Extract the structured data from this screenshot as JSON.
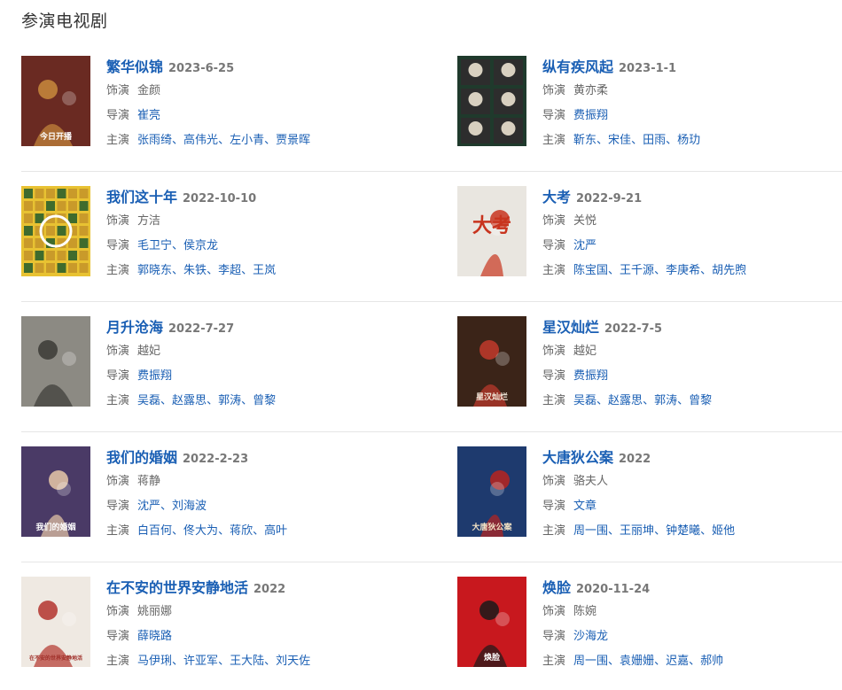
{
  "section_title": "参演电视剧",
  "labels": {
    "role": "饰演",
    "director": "导演",
    "cast": "主演"
  },
  "dramas": [
    {
      "title": "繁华似锦",
      "date": "2023-6-25",
      "role": "金颜",
      "directors": [
        "崔亮"
      ],
      "cast": [
        "张雨绮",
        "高伟光",
        "左小青",
        "贾景晖"
      ],
      "poster_text": "今日开播",
      "colors": {
        "bg": "#6a2a22",
        "accent": "#c8893c",
        "text": "#ffffff"
      }
    },
    {
      "title": "纵有疾风起",
      "date": "2023-1-1",
      "role": "黄亦柔",
      "directors": [
        "费振翔"
      ],
      "cast": [
        "靳东",
        "宋佳",
        "田雨",
        "杨玏"
      ],
      "poster_text": "",
      "colors": {
        "bg": "#1f3a2c",
        "accent": "#d8d0c0",
        "text": "#ffffff"
      }
    },
    {
      "title": "我们这十年",
      "date": "2022-10-10",
      "role": "方洁",
      "directors": [
        "毛卫宁",
        "侯京龙"
      ],
      "cast": [
        "郭晓东",
        "朱铁",
        "李超",
        "王岚"
      ],
      "poster_text": "",
      "colors": {
        "bg": "#e8c232",
        "accent": "#3f6b2d",
        "text": "#ffffff"
      }
    },
    {
      "title": "大考",
      "date": "2022-9-21",
      "role": "关悦",
      "directors": [
        "沈严"
      ],
      "cast": [
        "陈宝国",
        "王千源",
        "李庚希",
        "胡先煦"
      ],
      "poster_text": "大考",
      "colors": {
        "bg": "#e9e6e0",
        "accent": "#c8341e",
        "text": "#c8341e"
      }
    },
    {
      "title": "月升沧海",
      "date": "2022-7-27",
      "role": "越妃",
      "directors": [
        "费振翔"
      ],
      "cast": [
        "吴磊",
        "赵露思",
        "郭涛",
        "曾黎"
      ],
      "poster_text": "",
      "colors": {
        "bg": "#8c8a83",
        "accent": "#3b3a36",
        "text": "#ffffff"
      }
    },
    {
      "title": "星汉灿烂",
      "date": "2022-7-5",
      "role": "越妃",
      "directors": [
        "费振翔"
      ],
      "cast": [
        "吴磊",
        "赵露思",
        "郭涛",
        "曾黎"
      ],
      "poster_text": "星汉灿烂",
      "colors": {
        "bg": "#3b2418",
        "accent": "#c23a2c",
        "text": "#f0e6d8"
      }
    },
    {
      "title": "我们的婚姻",
      "date": "2022-2-23",
      "role": "蒋静",
      "directors": [
        "沈严",
        "刘海波"
      ],
      "cast": [
        "白百何",
        "佟大为",
        "蒋欣",
        "高叶"
      ],
      "poster_text": "我们的婚姻",
      "colors": {
        "bg": "#4a3a66",
        "accent": "#e8c9a8",
        "text": "#ffffff"
      }
    },
    {
      "title": "大唐狄公案",
      "date": "2022",
      "role": "骆夫人",
      "directors": [
        "文章"
      ],
      "cast": [
        "周一围",
        "王丽坤",
        "钟楚曦",
        "姬他"
      ],
      "poster_text": "大唐狄公案",
      "colors": {
        "bg": "#1e3a6e",
        "accent": "#b8241e",
        "text": "#f2e2c4"
      }
    },
    {
      "title": "在不安的世界安静地活",
      "date": "2022",
      "role": "姚丽娜",
      "directors": [
        "薛晓路"
      ],
      "cast": [
        "马伊琍",
        "许亚军",
        "王大陆",
        "刘天佐"
      ],
      "poster_text": "在不安的世界安静地活",
      "colors": {
        "bg": "#efe9e2",
        "accent": "#b3342e",
        "text": "#a0302a"
      }
    },
    {
      "title": "焕脸",
      "date": "2020-11-24",
      "role": "陈婉",
      "directors": [
        "沙海龙"
      ],
      "cast": [
        "周一围",
        "袁姗姗",
        "迟嘉",
        "郝帅"
      ],
      "poster_text": "焕脸",
      "colors": {
        "bg": "#c8181e",
        "accent": "#1a1a1a",
        "text": "#ffffff"
      }
    }
  ]
}
